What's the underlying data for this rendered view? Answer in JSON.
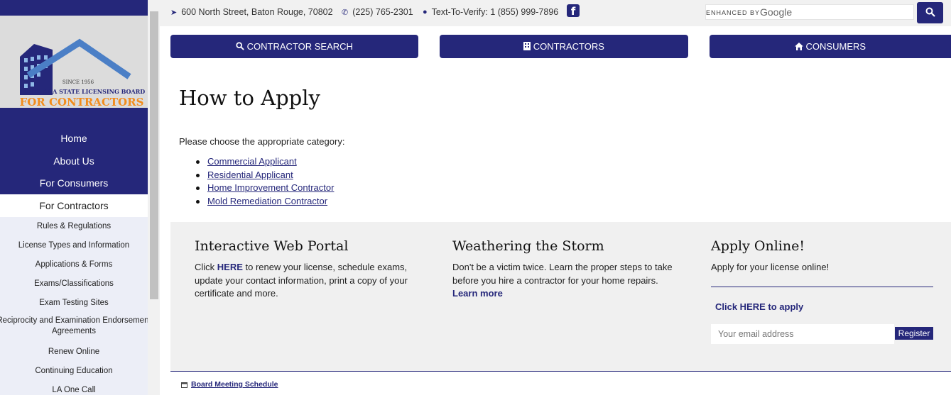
{
  "colors": {
    "brand": "#25277a",
    "panel": "#f0f0f0",
    "accent_orange": "#f28c1c"
  },
  "logo": {
    "since": "SINCE 1956",
    "line1": "LOUISIANA STATE LICENSING BOARD",
    "line2": "FOR CONTRACTORS"
  },
  "sidebar": {
    "main_items": [
      {
        "label": "Home"
      },
      {
        "label": "About Us"
      },
      {
        "label": "For Consumers"
      }
    ],
    "active_item": "For Contractors",
    "sub_items": [
      {
        "label": "Rules & Regulations"
      },
      {
        "label": "License Types and Information"
      },
      {
        "label": "Applications & Forms"
      },
      {
        "label": "Exams/Classifications"
      },
      {
        "label": "Exam Testing Sites"
      },
      {
        "label": "Reciprocity and Examination Endorsement Agreements"
      },
      {
        "label": "Renew Online"
      },
      {
        "label": "Continuing Education"
      },
      {
        "label": "LA One Call"
      }
    ]
  },
  "topbar": {
    "address": "600 North Street, Baton Rouge, 70802",
    "phone": "(225) 765-2301",
    "text_verify": "Text-To-Verify: 1 (855) 999-7896",
    "facebook_icon": "facebook-icon",
    "search_enhanced": "ENHANCED BY",
    "search_brand": "Google"
  },
  "nav_buttons": [
    {
      "label": "CONTRACTOR SEARCH",
      "icon": "search-icon"
    },
    {
      "label": "CONTRACTORS",
      "icon": "building-icon"
    },
    {
      "label": "CONSUMERS",
      "icon": "home-icon"
    }
  ],
  "main": {
    "title": "How to Apply",
    "intro": "Please choose the appropriate category:",
    "links": [
      {
        "label": "Commercial Applicant"
      },
      {
        "label": "Residential Applicant"
      },
      {
        "label": "Home Improvement Contractor"
      },
      {
        "label": "Mold Remediation Contractor"
      }
    ]
  },
  "panel": {
    "col1": {
      "title": "Interactive Web Portal",
      "pre": "Click ",
      "link": "HERE",
      "post": " to renew your license, schedule exams, update your contact information, print a copy of your certificate and more."
    },
    "col2": {
      "title": "Weathering the Storm",
      "text": "Don't be a victim twice. Learn the proper steps to take before you hire a contractor for your home repairs. ",
      "link": "Learn more"
    },
    "col3": {
      "title": "Apply Online!",
      "text": "Apply for your license online!",
      "click_here": "Click HERE to apply",
      "email_placeholder": "Your email address",
      "register_label": "Register"
    }
  },
  "footer": {
    "board_meeting": "Board Meeting Schedule"
  }
}
